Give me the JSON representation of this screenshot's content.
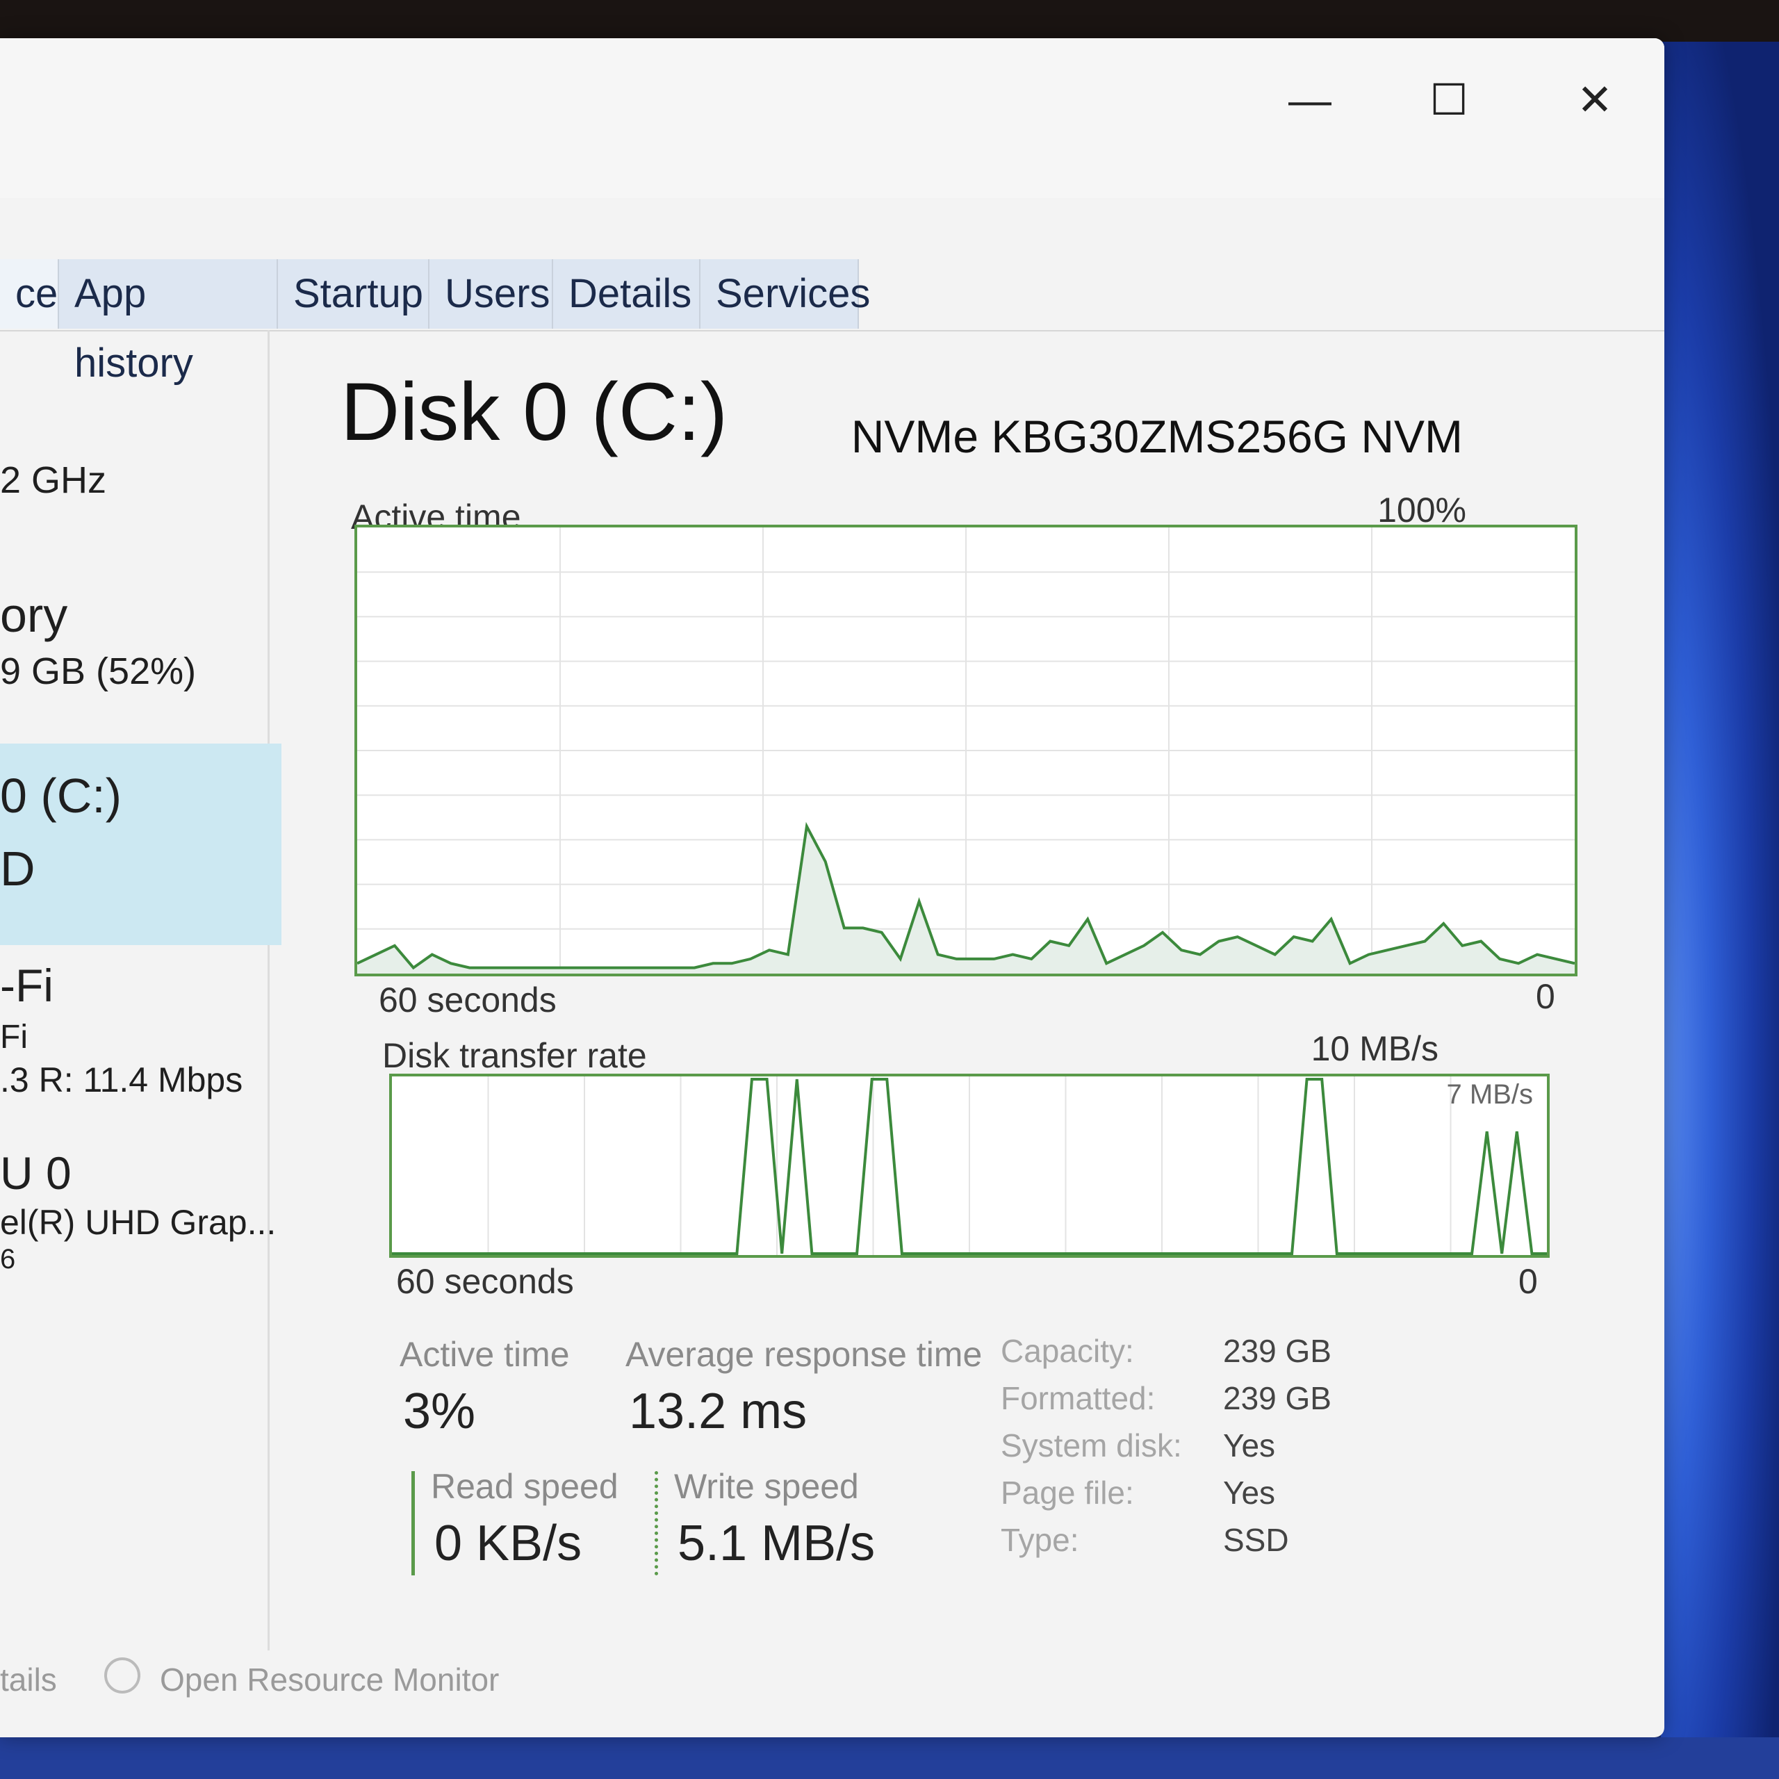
{
  "tabs": [
    "ce",
    "App history",
    "Startup",
    "Users",
    "Details",
    "Services"
  ],
  "window_buttons": {
    "minimize": "—",
    "maximize": "☐",
    "close": "✕"
  },
  "sidebar": {
    "cpu_speed": "2 GHz",
    "memory_title": "ory",
    "memory_value": "9 GB (52%)",
    "disk_title": "0 (C:)",
    "disk_sub": "D",
    "wifi_title": "-Fi",
    "wifi_sub": "Fi",
    "wifi_rate": ".3 R: 11.4 Mbps",
    "gpu_title": "U 0",
    "gpu_sub": "el(R) UHD Grap...",
    "gpu_pct": "6"
  },
  "main": {
    "title": "Disk 0 (C:)",
    "model": "NVMe KBG30ZMS256G NVM"
  },
  "active_chart": {
    "label": "Active time",
    "max_label": "100%",
    "time_label": "60 seconds",
    "zero_label": "0"
  },
  "transfer_chart": {
    "label": "Disk transfer rate",
    "max_label": "10 MB/s",
    "mid_label": "7 MB/s",
    "time_label": "60 seconds",
    "zero_label": "0"
  },
  "chart_data": [
    {
      "type": "area",
      "title": "Active time",
      "x_range": [
        60,
        0
      ],
      "ylim": [
        0,
        100
      ],
      "y_unit": "%",
      "grid": true,
      "values": [
        2,
        4,
        6,
        1,
        4,
        2,
        1,
        1,
        1,
        1,
        1,
        1,
        1,
        1,
        1,
        1,
        1,
        1,
        1,
        2,
        2,
        3,
        5,
        4,
        33,
        25,
        10,
        10,
        9,
        3,
        16,
        4,
        3,
        3,
        3,
        4,
        3,
        7,
        6,
        12,
        2,
        4,
        6,
        9,
        5,
        4,
        7,
        8,
        6,
        4,
        8,
        7,
        12,
        2,
        4,
        5,
        6,
        7,
        11,
        6,
        7,
        3,
        2,
        4,
        3,
        2
      ]
    },
    {
      "type": "line",
      "title": "Disk transfer rate",
      "x_range": [
        60,
        0
      ],
      "ylim": [
        0,
        10
      ],
      "y_unit": "MB/s",
      "grid": true,
      "values": [
        0,
        0,
        0,
        0,
        0,
        0,
        0,
        0,
        0,
        0,
        0,
        0,
        0,
        0,
        0,
        0,
        0,
        0,
        0,
        0,
        0,
        0,
        0,
        0,
        10,
        10,
        0,
        10,
        0,
        0,
        0,
        0,
        10,
        10,
        0,
        0,
        0,
        0,
        0,
        0,
        0,
        0,
        0,
        0,
        0,
        0,
        0,
        0,
        0,
        0,
        0,
        0,
        0,
        0,
        0,
        0,
        0,
        0,
        0,
        0,
        0,
        10,
        10,
        0,
        0,
        0,
        0,
        0,
        0,
        0,
        0,
        0,
        0,
        7,
        0,
        7,
        0,
        0
      ]
    }
  ],
  "stats": {
    "active_time_label": "Active time",
    "active_time_value": "3%",
    "avg_resp_label": "Average response time",
    "avg_resp_value": "13.2 ms",
    "read_label": "Read speed",
    "read_value": "0 KB/s",
    "write_label": "Write speed",
    "write_value": "5.1 MB/s"
  },
  "properties": [
    {
      "key": "Capacity:",
      "value": "239 GB"
    },
    {
      "key": "Formatted:",
      "value": "239 GB"
    },
    {
      "key": "System disk:",
      "value": "Yes"
    },
    {
      "key": "Page file:",
      "value": "Yes"
    },
    {
      "key": "Type:",
      "value": "SSD"
    }
  ],
  "footer": {
    "details": "tails",
    "resource_monitor": "Open Resource Monitor"
  },
  "colors": {
    "graph_line": "#3c8a3c",
    "graph_fill": "#e6efe9",
    "selection": "#cce8f2"
  }
}
